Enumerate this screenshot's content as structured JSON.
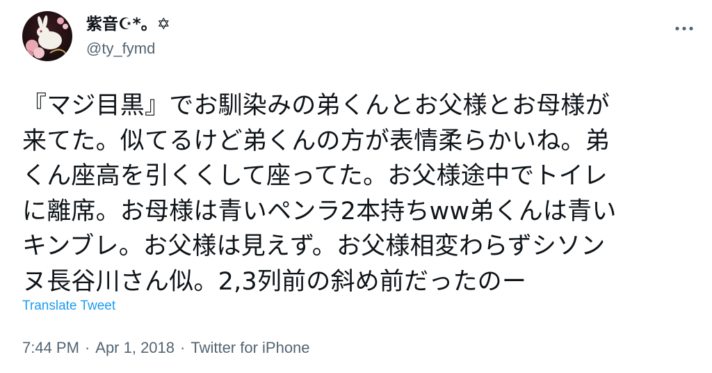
{
  "author": {
    "display_name": "紫音☪*。✡",
    "handle": "@ty_fymd"
  },
  "tweet": {
    "text": "『マジ目黒』でお馴染みの弟くんとお父様とお母様が\n来てた。似てるけど弟くんの方が表情柔らかいね。弟\nくん座高を引くくして座ってた。お父様途中でトイレ\nに離席。お母様は青いペンラ2本持ちww弟くんは青い\nキンブレ。お父様は見えず。お父様相変わらずシソン\nヌ長谷川さん似。2,3列前の斜め前だったのー",
    "translate_label": "Translate Tweet"
  },
  "meta": {
    "time": "7:44 PM",
    "separator": "·",
    "date": "Apr 1, 2018",
    "source": "Twitter for iPhone"
  },
  "icons": {
    "more": "more-horizontal-icon",
    "avatar": "rabbit-avatar"
  },
  "colors": {
    "text": "#0f1419",
    "secondary": "#536471",
    "link": "#1d9bf0"
  }
}
